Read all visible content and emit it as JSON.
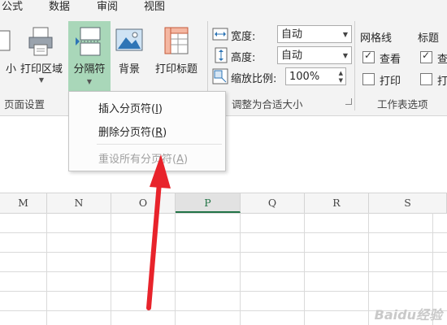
{
  "tabs": [
    "公式",
    "数据",
    "审阅",
    "视图"
  ],
  "page_setup": {
    "size_label_fragment": "小",
    "print_area_label": "打印区域",
    "breaks_label": "分隔符",
    "background_label": "背景",
    "print_titles_label": "打印标题",
    "group_label": "页面设置"
  },
  "scale_to_fit": {
    "width_label": "宽度:",
    "width_value": "自动",
    "height_label": "高度:",
    "height_value": "自动",
    "scale_label": "缩放比例:",
    "scale_value": "100%",
    "group_label": "调整为合适大小"
  },
  "sheet_options": {
    "gridlines_label": "网格线",
    "headings_label": "标题",
    "view_label": "查看",
    "print_label": "打印",
    "view_label_cut": "查",
    "print_label_cut": "打",
    "gridlines_view_checked": true,
    "gridlines_print_checked": false,
    "headings_view_checked": true,
    "headings_print_checked": false,
    "group_label": "工作表选项"
  },
  "breaks_menu": {
    "insert": {
      "text": "插入分页符(",
      "key": "I",
      "end": ")"
    },
    "remove": {
      "text": "删除分页符(",
      "key": "R",
      "end": ")"
    },
    "reset": {
      "text": "重设所有分页符(",
      "key": "A",
      "end": ")"
    }
  },
  "columns": [
    "M",
    "N",
    "O",
    "P",
    "Q",
    "R",
    "S"
  ],
  "selected_column": "P",
  "watermark": "Baidu经验",
  "colors": {
    "accent": "#217346",
    "arrow": "#e8232b",
    "breaks_highlight": "#a9d7b9"
  }
}
